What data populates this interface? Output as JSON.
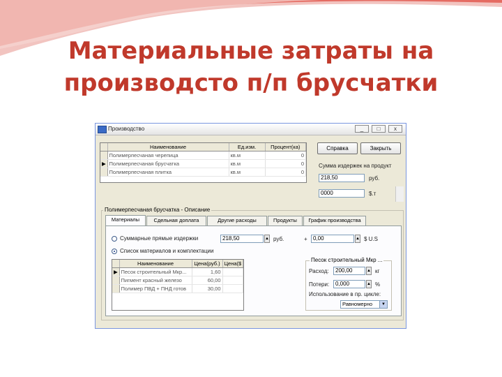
{
  "slide": {
    "title_line1": "Материальные затраты на",
    "title_line2": "производсто п/п брусчатки"
  },
  "window": {
    "title": "Производство",
    "minimize": "_",
    "maximize": "□",
    "close": "x"
  },
  "top_grid": {
    "headers": [
      "Наименование",
      "Ед.изм.",
      "Процент(ка)"
    ],
    "rows": [
      {
        "indicator": "",
        "name": "Полимерпесчаная черепица",
        "unit": "кв.м",
        "value": "0"
      },
      {
        "indicator": "▶",
        "name": "Полимерпесчаная брусчатка",
        "unit": "кв.м",
        "value": "0"
      },
      {
        "indicator": "",
        "name": "Полимерпесчаная плитка",
        "unit": "кв.м",
        "value": "0"
      }
    ]
  },
  "buttons": {
    "help": "Справка",
    "close": "Закрыть"
  },
  "summary": {
    "label": "Сумма издержек на продукт",
    "value_rub": "218,50",
    "unit_rub": "руб.",
    "value_usd": "0000",
    "unit_usd": "$.т"
  },
  "description_group": {
    "title": "Полимерпесчаная брусчатка - Описание"
  },
  "tabs": [
    {
      "label": "Материалы",
      "active": true
    },
    {
      "label": "Сдельная доплата",
      "active": false
    },
    {
      "label": "Другие расходы",
      "active": false
    },
    {
      "label": "Продукты",
      "active": false
    },
    {
      "label": "График производства",
      "active": false
    }
  ],
  "materials": {
    "radio_direct": "Суммарные прямые издержки",
    "direct_value": "218,50",
    "direct_unit": "руб.",
    "plus": "+",
    "usd_value": "0,00",
    "usd_unit": "$ U.S",
    "radio_list": "Список материалов и комплектации",
    "grid_headers": [
      "Наименование",
      "Цена(руб.)",
      "Цена($ U.S)"
    ],
    "grid_rows": [
      {
        "indicator": "▶",
        "name": "Песок строительный Мкр...",
        "price_rub": "1,60",
        "price_usd": ""
      },
      {
        "indicator": "",
        "name": "Пигмент красный железо",
        "price_rub": "60,00",
        "price_usd": ""
      },
      {
        "indicator": "",
        "name": "Полимер ПВД + ПНД готов",
        "price_rub": "30,00",
        "price_usd": ""
      }
    ]
  },
  "sand_group": {
    "title": "Песок строительный Мкр ...",
    "consumption_label": "Расход:",
    "consumption_value": "200,00",
    "consumption_unit": "кг",
    "loss_label": "Потери:",
    "loss_value": "0,000",
    "loss_unit": "%",
    "use_label": "Использование в пр. цикле:",
    "use_value": "Равномерно"
  }
}
